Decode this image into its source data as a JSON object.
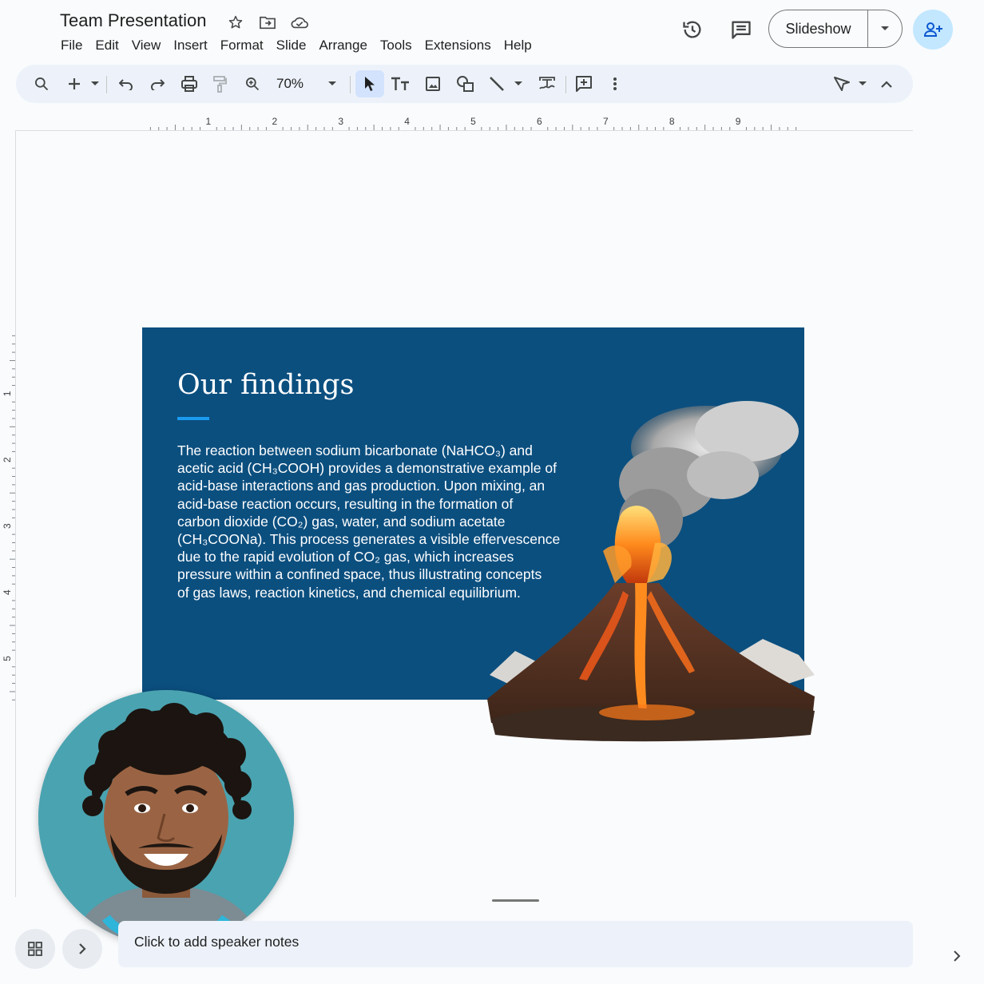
{
  "app": {
    "document_title": "Team Presentation"
  },
  "menu": [
    "File",
    "Edit",
    "View",
    "Insert",
    "Format",
    "Slide",
    "Arrange",
    "Tools",
    "Extensions",
    "Help"
  ],
  "header": {
    "slideshow_label": "Slideshow"
  },
  "toolbar": {
    "zoom": "70%"
  },
  "ruler": {
    "horizontal_numbers": [
      "1",
      "2",
      "3",
      "4",
      "5",
      "6",
      "7",
      "8",
      "9"
    ],
    "vertical_numbers": [
      "1",
      "2",
      "3",
      "4",
      "5"
    ]
  },
  "slide": {
    "title": "Our findings",
    "body_lines": [
      "The reaction between sodium bicarbonate (NaHCO₃) and",
      "acetic acid (CH₃COOH) provides a demonstrative example of",
      "acid-base interactions and gas production. Upon mixing, an",
      "acid-base reaction occurs, resulting in the formation of",
      "carbon dioxide (CO₂) gas, water, and sodium acetate",
      "(CH₃COONa). This process generates a visible effervescence",
      "due to the rapid evolution of CO₂ gas, which increases",
      "pressure within a confined space, thus illustrating concepts",
      "of gas laws, reaction kinetics, and chemical equilibrium."
    ],
    "background_color": "#0b4f7f",
    "accent_color": "#1a9bf0"
  },
  "notes": {
    "placeholder": "Click to add speaker notes"
  },
  "colors": {
    "toolbar_bg": "#edf2fa",
    "share_bg": "#c2e7ff",
    "active_tool_bg": "#d3e3fd"
  }
}
